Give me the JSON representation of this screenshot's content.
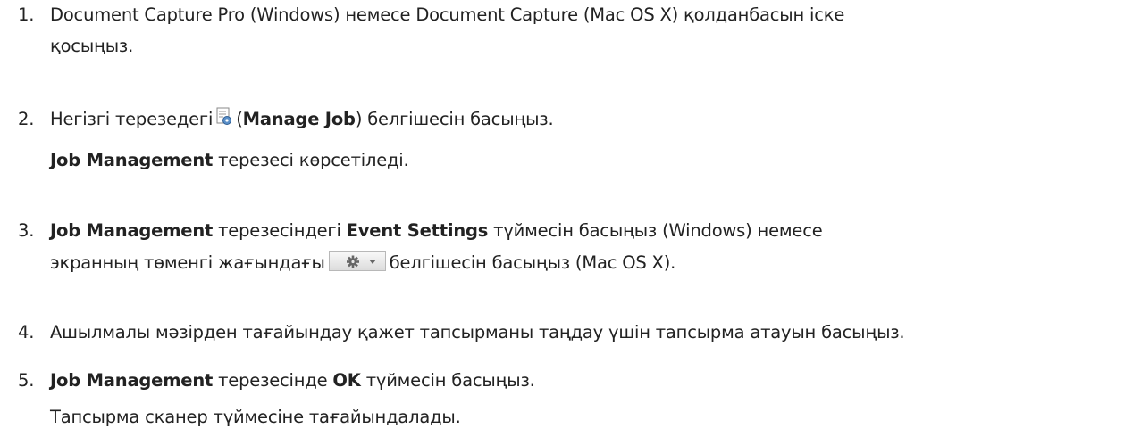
{
  "steps": [
    {
      "number": "1.",
      "line1": "Document Capture Pro (Windows) немесе Document Capture (Mac OS X) қолданбасын іске",
      "line2": "қосыңыз."
    },
    {
      "number": "2.",
      "pre": "Негізгі терезедегі",
      "icon": "manage-job-icon",
      "paren_open": "(",
      "bold": "Manage Job",
      "post": ") белгішесін басыңыз.",
      "result_bold": "Job Management",
      "result_rest": " терезесі көрсетіледі."
    },
    {
      "number": "3.",
      "bold1": "Job Management",
      "mid1": " терезесіндегі ",
      "bold2": "Event Settings",
      "mid2": " түймесін басыңыз (Windows) немесе",
      "line2_pre": "экранның төменгі жағындағы",
      "icon": "gear-dropdown-icon",
      "line2_post": "белгішесін басыңыз (Mac OS X)."
    },
    {
      "number": "4.",
      "text": "Ашылмалы мәзірден тағайындау қажет тапсырманы таңдау үшін тапсырма атауын басыңыз."
    },
    {
      "number": "5.",
      "bold1": "Job Management",
      "mid1": " терезесінде ",
      "bold2": "OK",
      "mid2": " түймесін басыңыз.",
      "result": "Тапсырма сканер түймесіне тағайындалады."
    }
  ]
}
